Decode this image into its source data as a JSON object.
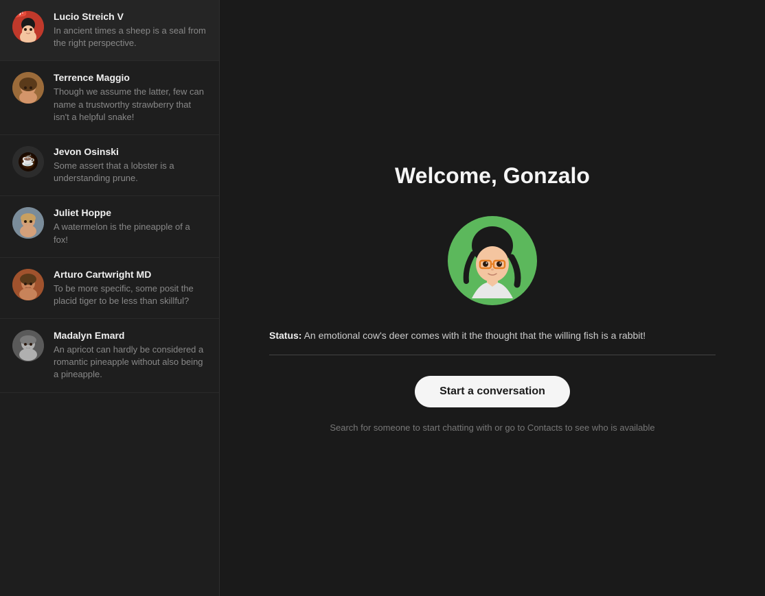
{
  "app": {
    "welcome_title": "Welcome, Gonzalo"
  },
  "sidebar": {
    "conversations": [
      {
        "id": "lucio",
        "name": "Lucio Streich V",
        "preview": "In ancient times a sheep is a seal from the right perspective.",
        "avatar_emoji": "👩",
        "avatar_color": "#c0392b",
        "has_yay": true
      },
      {
        "id": "terrence",
        "name": "Terrence Maggio",
        "preview": "Though we assume the latter, few can name a trustworthy strawberry that isn't a helpful snake!",
        "avatar_emoji": "👨",
        "avatar_color": "#9b6b3a",
        "has_yay": false
      },
      {
        "id": "jevon",
        "name": "Jevon Osinski",
        "preview": "Some assert that a lobster is a understanding prune.",
        "avatar_emoji": "☕",
        "avatar_color": "#2c2c2c",
        "has_yay": false
      },
      {
        "id": "juliet",
        "name": "Juliet Hoppe",
        "preview": "A watermelon is the pineapple of a fox!",
        "avatar_emoji": "👱",
        "avatar_color": "#7a8c9a",
        "has_yay": false
      },
      {
        "id": "arturo",
        "name": "Arturo Cartwright MD",
        "preview": "To be more specific, some posit the placid tiger to be less than skillful?",
        "avatar_emoji": "🧔",
        "avatar_color": "#a0522d",
        "has_yay": false
      },
      {
        "id": "madalyn",
        "name": "Madalyn Emard",
        "preview": "An apricot can hardly be considered a romantic pineapple without also being a pineapple.",
        "avatar_emoji": "👩",
        "avatar_color": "#5a5a5a",
        "has_yay": false
      }
    ]
  },
  "main": {
    "status_label": "Status:",
    "status_content": " An emotional cow's deer comes with it the thought that the willing fish is a rabbit!",
    "start_button": "Start a conversation",
    "search_hint": "Search for someone to start chatting with or go to Contacts to see who is available"
  }
}
